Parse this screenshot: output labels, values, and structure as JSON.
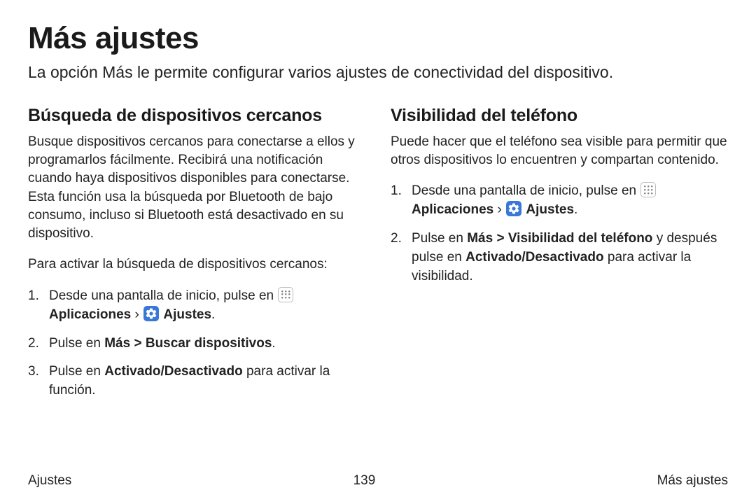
{
  "page_title": "Más ajustes",
  "intro": "La opción Más le permite configurar varios ajustes de conectividad del dispositivo.",
  "left": {
    "heading": "Búsqueda de dispositivos cercanos",
    "para": "Busque dispositivos cercanos para conectarse a ellos y programarlos fácilmente. Recibirá una notificación cuando haya dispositivos disponibles para conectarse. Esta función usa la búsqueda por Bluetooth de bajo consumo, incluso si Bluetooth está desactivado en su dispositivo.",
    "lead": "Para activar la búsqueda de dispositivos cercanos:",
    "step1_pre": "Desde una pantalla de inicio, pulse en ",
    "apps_label": "Aplicaciones",
    "settings_label": "Ajustes",
    "step2_pre": "Pulse en ",
    "step2_bold": "Más > Buscar dispositivos",
    "step3_pre": "Pulse en ",
    "step3_bold": "Activado/Desactivado",
    "step3_post": " para activar la función."
  },
  "right": {
    "heading": "Visibilidad del teléfono",
    "para": "Puede hacer que el teléfono sea visible para permitir que otros dispositivos lo encuentren y compartan contenido.",
    "step1_pre": "Desde una pantalla de inicio, pulse en ",
    "apps_label": "Aplicaciones",
    "settings_label": "Ajustes",
    "step2_pre": "Pulse en ",
    "step2_bold1": "Más > Visibilidad del teléfono",
    "step2_mid": " y después pulse en ",
    "step2_bold2": "Activado/Desactivado",
    "step2_post": " para activar la visibilidad."
  },
  "footer": {
    "left": "Ajustes",
    "center": "139",
    "right": "Más ajustes"
  },
  "glyphs": {
    "rangle": " › ",
    "period": "."
  }
}
